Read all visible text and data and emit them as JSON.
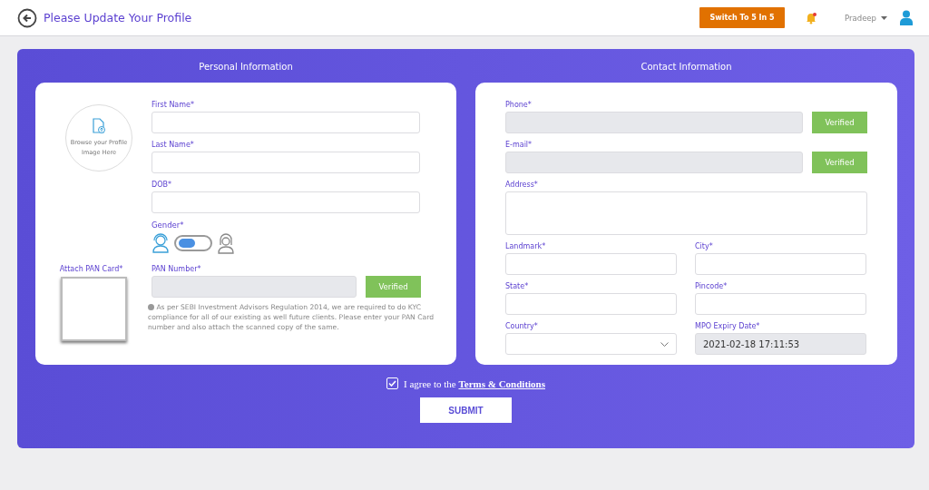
{
  "header": {
    "title": "Please Update Your Profile",
    "switch_button": "Switch To 5 In 5",
    "user": "Pradeep"
  },
  "personal": {
    "heading": "Personal Information",
    "upload_hint": "Browse your Profile Image Here",
    "fields": [
      {
        "label": "First Name*"
      },
      {
        "label": "Last Name*"
      },
      {
        "label": "DOB*"
      }
    ],
    "gender": {
      "label": "Gender*",
      "on": false
    },
    "pan_card_label": "Attach PAN Card*",
    "pan": {
      "label": "PAN Number*",
      "disabled": true,
      "status": "Verified"
    },
    "note": "As per SEBI Investment Advisors Regulation 2014, we are required to do KYC compliance for all of our existing as well future clients. Please enter your PAN Card number and also attach the scanned copy of the same."
  },
  "contact": {
    "heading": "Contact Information",
    "rows": [
      [
        {
          "label": "Phone*",
          "kind": "text",
          "disabled": true,
          "status": "Verified"
        }
      ],
      [
        {
          "label": "E-mail*",
          "kind": "text",
          "disabled": true,
          "status": "Verified"
        }
      ],
      [
        {
          "label": "Address*",
          "kind": "textarea",
          "disabled": false
        }
      ],
      [
        {
          "label": "Landmark*",
          "kind": "text",
          "disabled": false
        },
        {
          "label": "City*",
          "kind": "text",
          "disabled": false
        }
      ],
      [
        {
          "label": "State*",
          "kind": "text",
          "disabled": false
        },
        {
          "label": "Pincode*",
          "kind": "text",
          "disabled": false
        }
      ],
      [
        {
          "label": "Country*",
          "kind": "select",
          "disabled": false
        },
        {
          "label": "MPO Expiry Date*",
          "kind": "text",
          "disabled": true,
          "value": "2021-02-18 17:11:53"
        }
      ]
    ]
  },
  "agree": {
    "checked": true,
    "text": "I agree to the",
    "link": "Terms & Conditions"
  },
  "submit": "SUBMIT"
}
